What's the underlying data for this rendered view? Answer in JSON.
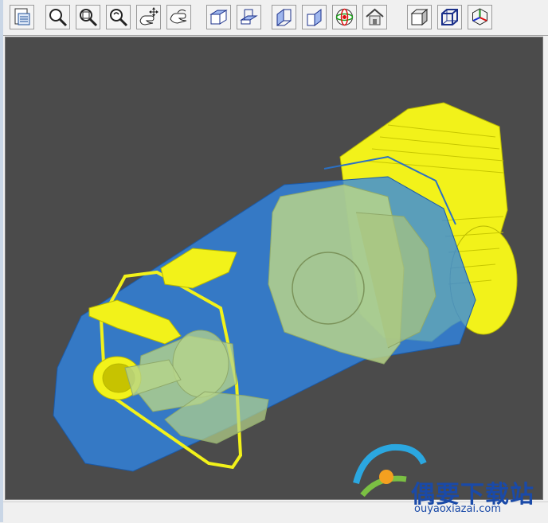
{
  "toolbar": {
    "buttons": [
      {
        "name": "print-preview-icon"
      },
      {
        "name": "zoom-icon"
      },
      {
        "name": "zoom-window-icon"
      },
      {
        "name": "zoom-rotate-icon"
      },
      {
        "name": "pan-icon"
      },
      {
        "name": "rotate-hand-icon"
      },
      {
        "name": "view-top-icon"
      },
      {
        "name": "view-bottom-icon"
      },
      {
        "name": "view-left-icon"
      },
      {
        "name": "view-right-icon"
      },
      {
        "name": "view-sphere-icon"
      },
      {
        "name": "home-view-icon"
      },
      {
        "name": "shaded-cube-icon"
      },
      {
        "name": "wireframe-cube-icon"
      },
      {
        "name": "axes-icon"
      }
    ]
  },
  "colors": {
    "viewport_bg": "#4b4b4b",
    "housing_blue": "#2f86e8",
    "motor_yellow": "#f2f21a",
    "inner_green": "#b7d48a"
  },
  "watermark": {
    "text": "偶要下载站",
    "url": "ouyaoxiazai.com"
  }
}
